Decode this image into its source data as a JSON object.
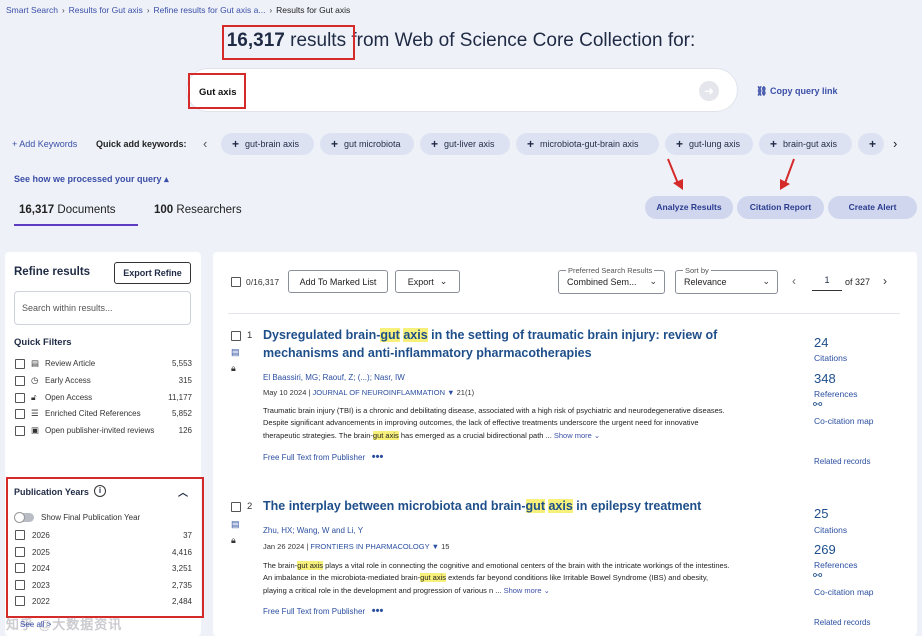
{
  "breadcrumb": [
    "Smart Search",
    "Results for Gut axis",
    "Refine results for Gut axis a...",
    "Results for Gut axis"
  ],
  "headline": {
    "count": "16,317",
    "results_word": "results",
    "rest": "from Web of Science Core Collection for:"
  },
  "search": {
    "query": "Gut axis",
    "go_icon": "arrow-right-icon",
    "copy_link": "Copy query link"
  },
  "keywords": {
    "add_label": "+ Add Keywords",
    "quick_label": "Quick add keywords:",
    "chips": [
      "gut-brain axis",
      "gut microbiota",
      "gut-liver axis",
      "microbiota-gut-brain axis",
      "gut-lung axis",
      "brain-gut axis",
      ""
    ]
  },
  "see_how": "See how we processed your query",
  "tabs": [
    {
      "count": "16,317",
      "label": "Documents"
    },
    {
      "count": "100",
      "label": "Researchers"
    }
  ],
  "actions": {
    "analyze": "Analyze Results",
    "citation": "Citation Report",
    "alert": "Create Alert"
  },
  "refine": {
    "title": "Refine results",
    "export": "Export Refine",
    "search_placeholder": "Search within results...",
    "quick_filters_title": "Quick Filters",
    "quick_filters": [
      {
        "icon": "document-icon",
        "label": "Review Article",
        "count": "5,553"
      },
      {
        "icon": "clock-icon",
        "label": "Early Access",
        "count": "315"
      },
      {
        "icon": "open-lock-icon",
        "label": "Open Access",
        "count": "11,177"
      },
      {
        "icon": "list-icon",
        "label": "Enriched Cited References",
        "count": "5,852"
      },
      {
        "icon": "comment-icon",
        "label": "Open publisher-invited reviews",
        "count": "126"
      }
    ],
    "pub_years_title": "Publication Years",
    "show_final": "Show Final Publication Year",
    "years": [
      {
        "year": "2026",
        "count": "37"
      },
      {
        "year": "2025",
        "count": "4,416"
      },
      {
        "year": "2024",
        "count": "3,251"
      },
      {
        "year": "2023",
        "count": "2,735"
      },
      {
        "year": "2022",
        "count": "2,484"
      }
    ],
    "see_all": "See all >",
    "watermark": "知乎 @大数据资讯"
  },
  "toolbar": {
    "selected": "0/16,317",
    "add_marked": "Add To Marked List",
    "export": "Export",
    "pref_label": "Preferred Search Results",
    "pref_value": "Combined Sem...",
    "sort_label": "Sort by",
    "sort_value": "Relevance",
    "page": "1",
    "of_pages": "of 327"
  },
  "records": [
    {
      "num": "1",
      "title_a": "Dysregulated brain-",
      "title_b": " in the setting of traumatic brain injury: review of mechanisms and anti-inflammatory pharmacotherapies",
      "authors": "El Baassiri, MG; Raouf, Z; (...); Nasr, IW",
      "date": "May 10 2024",
      "journal": "JOURNAL OF NEUROINFLAMMATION",
      "vol": "21(1)",
      "abstract": "Traumatic brain injury (TBI) is a chronic and debilitating disease, associated with a high risk of psychiatric and neurodegenerative diseases. Despite significant advancements in improving outcomes, the lack of effective treatments underscore the urgent need for innovative therapeutic strategies. The brain-",
      "abstract_end": " has emerged as a crucial bidirectional path ...",
      "show_more": "Show more",
      "full_text": "Free Full Text from Publisher",
      "citations": "24",
      "citations_label": "Citations",
      "references": "348",
      "references_label": "References",
      "cocitation": "Co-citation map",
      "related": "Related records"
    },
    {
      "num": "2",
      "title_a": "The interplay between microbiota and brain-",
      "title_b": " in epilepsy treatment",
      "authors": "Zhu, HX; Wang, W and Li, Y",
      "date": "Jan 26 2024",
      "journal": "FRONTIERS IN PHARMACOLOGY",
      "vol": "15",
      "abstract_pre": "The brain-",
      "abstract": " plays a vital role in connecting the cognitive and emotional centers of the brain with the intricate workings of the intestines. An imbalance in the microbiota-mediated brain-",
      "abstract_end": " extends far beyond conditions like Irritable Bowel Syndrome (IBS) and obesity, playing a critical role in the development and progression of various n ...",
      "show_more": "Show more",
      "full_text": "Free Full Text from Publisher",
      "citations": "25",
      "citations_label": "Citations",
      "references": "269",
      "references_label": "References",
      "cocitation": "Co-citation map",
      "related": "Related records"
    }
  ],
  "highlight_term": "gut axis",
  "highlight_gut": "gut",
  "highlight_axis": "axis",
  "colors": {
    "accent": "#5d3cc4",
    "link": "#3b4fa8",
    "annotation_red": "#d42a2a",
    "highlight": "#f7f07a"
  }
}
